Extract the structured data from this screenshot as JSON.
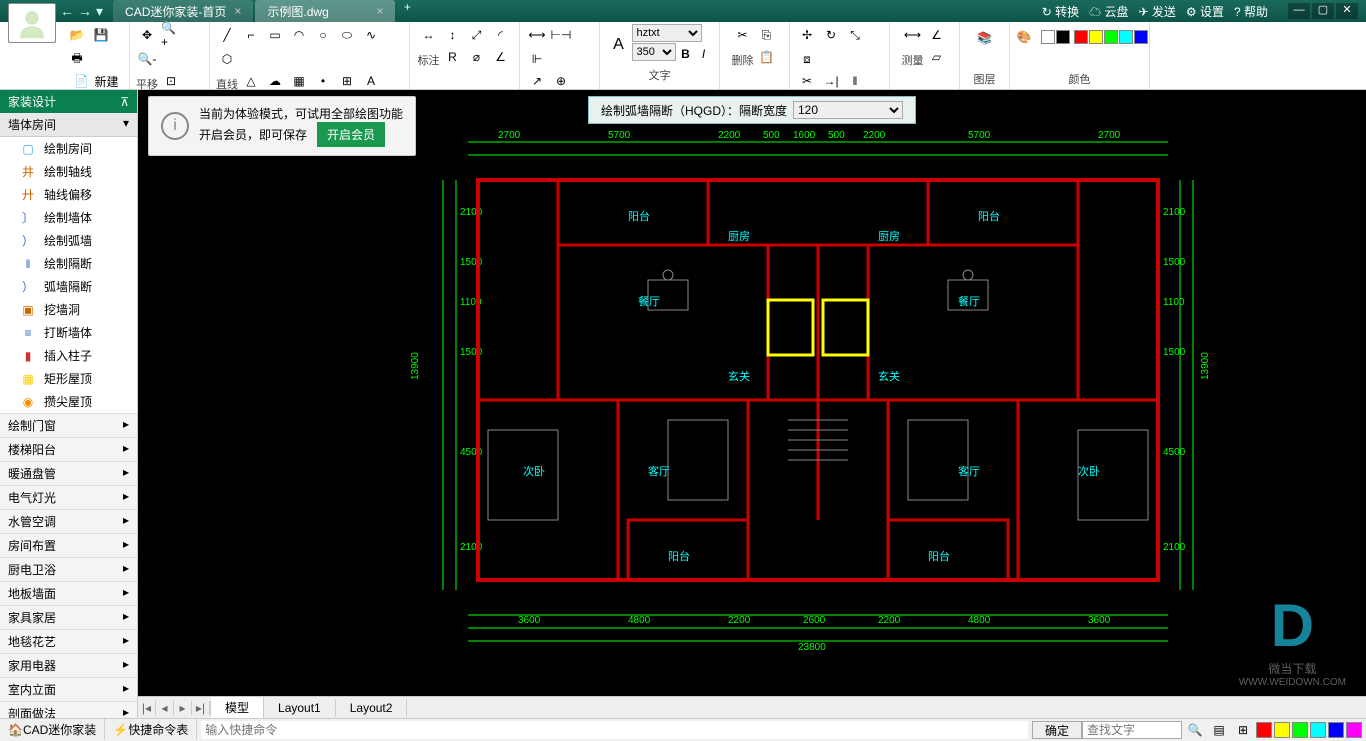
{
  "titlebar": {
    "tabs": [
      {
        "label": "CAD迷你家装-首页",
        "active": false
      },
      {
        "label": "示例图.dwg",
        "active": true
      }
    ],
    "right": {
      "convert": "↻ 转换",
      "cloud": "☁ 云盘",
      "send": "✈ 发送",
      "settings": "⚙ 设置",
      "help": "? 帮助"
    }
  },
  "ribbon": {
    "new": "新建",
    "pan": "平移",
    "line": "直线",
    "annotate": "标注",
    "text": "文字",
    "font": "hztxt",
    "size": "350",
    "delete": "删除",
    "measure": "测量",
    "layer": "图层",
    "color": "颜色"
  },
  "sidebar": {
    "header": "家装设计",
    "sub": "墙体房间",
    "items": [
      {
        "icon": "▢",
        "label": "绘制房间"
      },
      {
        "icon": "井",
        "label": "绘制轴线"
      },
      {
        "icon": "廾",
        "label": "轴线偏移"
      },
      {
        "icon": "〕",
        "label": "绘制墙体"
      },
      {
        "icon": "）",
        "label": "绘制弧墙"
      },
      {
        "icon": "‖",
        "label": "绘制隔断"
      },
      {
        "icon": "）",
        "label": "弧墙隔断"
      },
      {
        "icon": "▣",
        "label": "挖墙洞"
      },
      {
        "icon": "≡",
        "label": "打断墙体"
      },
      {
        "icon": "▮",
        "label": "插入柱子"
      },
      {
        "icon": "▦",
        "label": "矩形屋顶"
      },
      {
        "icon": "◉",
        "label": "攒尖屋顶"
      }
    ],
    "cats": [
      "绘制门窗",
      "楼梯阳台",
      "暖通盘管",
      "电气灯光",
      "水管空调",
      "房间布置",
      "厨电卫浴",
      "地板墙面",
      "家具家居",
      "地毯花艺",
      "家用电器",
      "室内立面",
      "剖面做法"
    ]
  },
  "notice": {
    "line1": "当前为体验模式，可试用全部绘图功能",
    "line2": "开启会员，即可保存",
    "btn": "开启会员"
  },
  "param": {
    "label": "绘制弧墙隔断（HQGD）：隔断宽度",
    "value": "120"
  },
  "floorplan": {
    "dims_top": [
      "2700",
      "5700",
      "2200",
      "500",
      "1600",
      "500",
      "2200",
      "5700",
      "2700"
    ],
    "dims_bottom": [
      "3600",
      "4800",
      "2200",
      "2600",
      "2200",
      "4800",
      "3600"
    ],
    "total_width": "23800",
    "total_height": "13900",
    "dims_left": [
      "2100",
      "1500",
      "1100",
      "1500",
      "4500",
      "2100"
    ],
    "rooms": [
      "阳台",
      "厨房",
      "厨房",
      "阳台",
      "餐厅",
      "餐厅",
      "玄关",
      "玄关",
      "次卧",
      "客厅",
      "客厅",
      "次卧",
      "阳台",
      "阳台"
    ]
  },
  "layout_tabs": [
    "模型",
    "Layout1",
    "Layout2"
  ],
  "statusbar": {
    "app": "CAD迷你家装",
    "shortcut": "快捷命令表",
    "input_ph": "输入快捷命令",
    "ok": "确定",
    "search_ph": "查找文字"
  },
  "watermark": {
    "name": "微当下载",
    "url": "WWW.WEIDOWN.COM"
  }
}
